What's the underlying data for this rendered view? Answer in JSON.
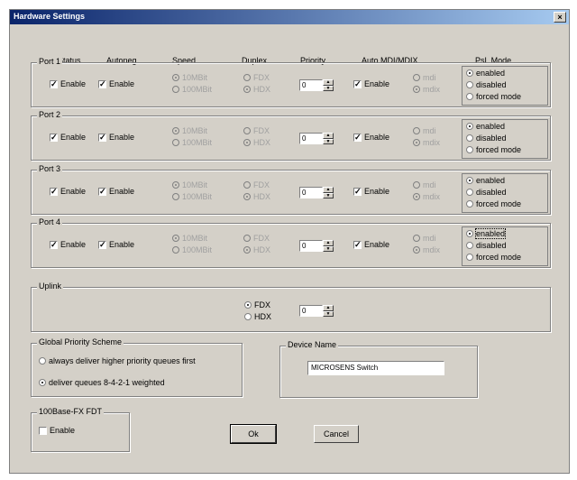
{
  "window": {
    "title": "Hardware Settings",
    "close_glyph": "×"
  },
  "headers": {
    "status": "Status",
    "autoneg": "Autoneg",
    "speed": "Speed",
    "duplex": "Duplex",
    "priority": "Priority",
    "auto_mdi": "Auto MDI/MDIX",
    "pse_mode": "PsL Mode"
  },
  "ports": [
    {
      "label": "Port 1",
      "status": "Enable",
      "autoneg": "Enable",
      "speed_10": "10MBit",
      "speed_100": "100MBit",
      "fdx": "FDX",
      "hdx": "HDX",
      "priority": "0",
      "mdi_enable": "Enable",
      "mdi": "mdi",
      "mdix": "mdix",
      "pse_enabled": "enabled",
      "pse_disabled": "disabled",
      "pse_forced": "forced mode"
    },
    {
      "label": "Port 2",
      "status": "Enable",
      "autoneg": "Enable",
      "speed_10": "10MBit",
      "speed_100": "100MBit",
      "fdx": "FDX",
      "hdx": "HDX",
      "priority": "0",
      "mdi_enable": "Enable",
      "mdi": "mdi",
      "mdix": "mdix",
      "pse_enabled": "enabled",
      "pse_disabled": "disabled",
      "pse_forced": "forced mode"
    },
    {
      "label": "Port 3",
      "status": "Enable",
      "autoneg": "Enable",
      "speed_10": "10MBit",
      "speed_100": "100MBit",
      "fdx": "FDX",
      "hdx": "HDX",
      "priority": "0",
      "mdi_enable": "Enable",
      "mdi": "mdi",
      "mdix": "mdix",
      "pse_enabled": "enabled",
      "pse_disabled": "disabled",
      "pse_forced": "forced mode"
    },
    {
      "label": "Port 4",
      "status": "Enable",
      "autoneg": "Enable",
      "speed_10": "10MBit",
      "speed_100": "100MBit",
      "fdx": "FDX",
      "hdx": "HDX",
      "priority": "0",
      "mdi_enable": "Enable",
      "mdi": "mdi",
      "mdix": "mdix",
      "pse_enabled": "enabled",
      "pse_disabled": "disabled",
      "pse_forced": "forced mode"
    }
  ],
  "uplink": {
    "label": "Uplink",
    "fdx": "FDX",
    "hdx": "HDX",
    "priority": "0"
  },
  "priority_scheme": {
    "label": "Global Priority Scheme",
    "opt1": "always deliver higher priority queues first",
    "opt2": "deliver queues 8-4-2-1 weighted"
  },
  "device_name": {
    "label": "Device Name",
    "value": "MICROSENS Switch"
  },
  "fx": {
    "label": "100Base-FX FDT",
    "enable": "Enable"
  },
  "buttons": {
    "ok": "Ok",
    "cancel": "Cancel"
  },
  "glyphs": {
    "check": "✓",
    "up": "▲",
    "down": "▼"
  }
}
